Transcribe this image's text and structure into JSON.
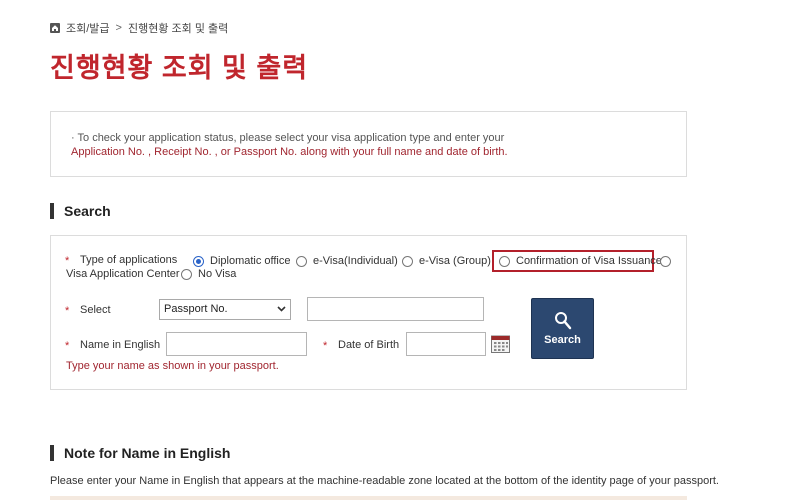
{
  "breadcrumb": {
    "items": [
      "조회/발급",
      "진행현황 조회 및 출력"
    ],
    "separator": ">"
  },
  "page_title": "진행현황 조회 및 출력",
  "info": {
    "line1": "· To check your application status, please select your visa application type and enter your",
    "line2": "Application No. , Receipt No. , or Passport No. along with your full name and date of birth."
  },
  "search_section": {
    "title": "Search"
  },
  "form": {
    "required_mark": "*",
    "type_label": "Type of applications",
    "options": [
      {
        "label": "Diplomatic office",
        "checked": true
      },
      {
        "label": "e-Visa(Individual)",
        "checked": false
      },
      {
        "label": "e-Visa (Group)",
        "checked": false
      },
      {
        "label": "Confirmation of Visa Issuance",
        "checked": false
      },
      {
        "label": "Visa Application Center",
        "checked": false
      },
      {
        "label": "No Visa",
        "checked": false
      }
    ],
    "select_label": "Select",
    "select_value": "Passport No.",
    "name_label": "Name in English",
    "dob_label": "Date of Birth",
    "hint": "Type your name as shown in your passport.",
    "search_button": "Search"
  },
  "note_section": {
    "title": "Note for Name in English",
    "text": "Please enter your Name in English that appears at the machine-readable zone located at the bottom of the identity page of your passport."
  },
  "colors": {
    "accent_red": "#c0262d",
    "button_navy": "#2c4870",
    "radio_blue": "#2a63c8"
  },
  "icons": [
    "home-icon",
    "search-icon",
    "calendar-icon",
    "chevron-down-icon"
  ]
}
